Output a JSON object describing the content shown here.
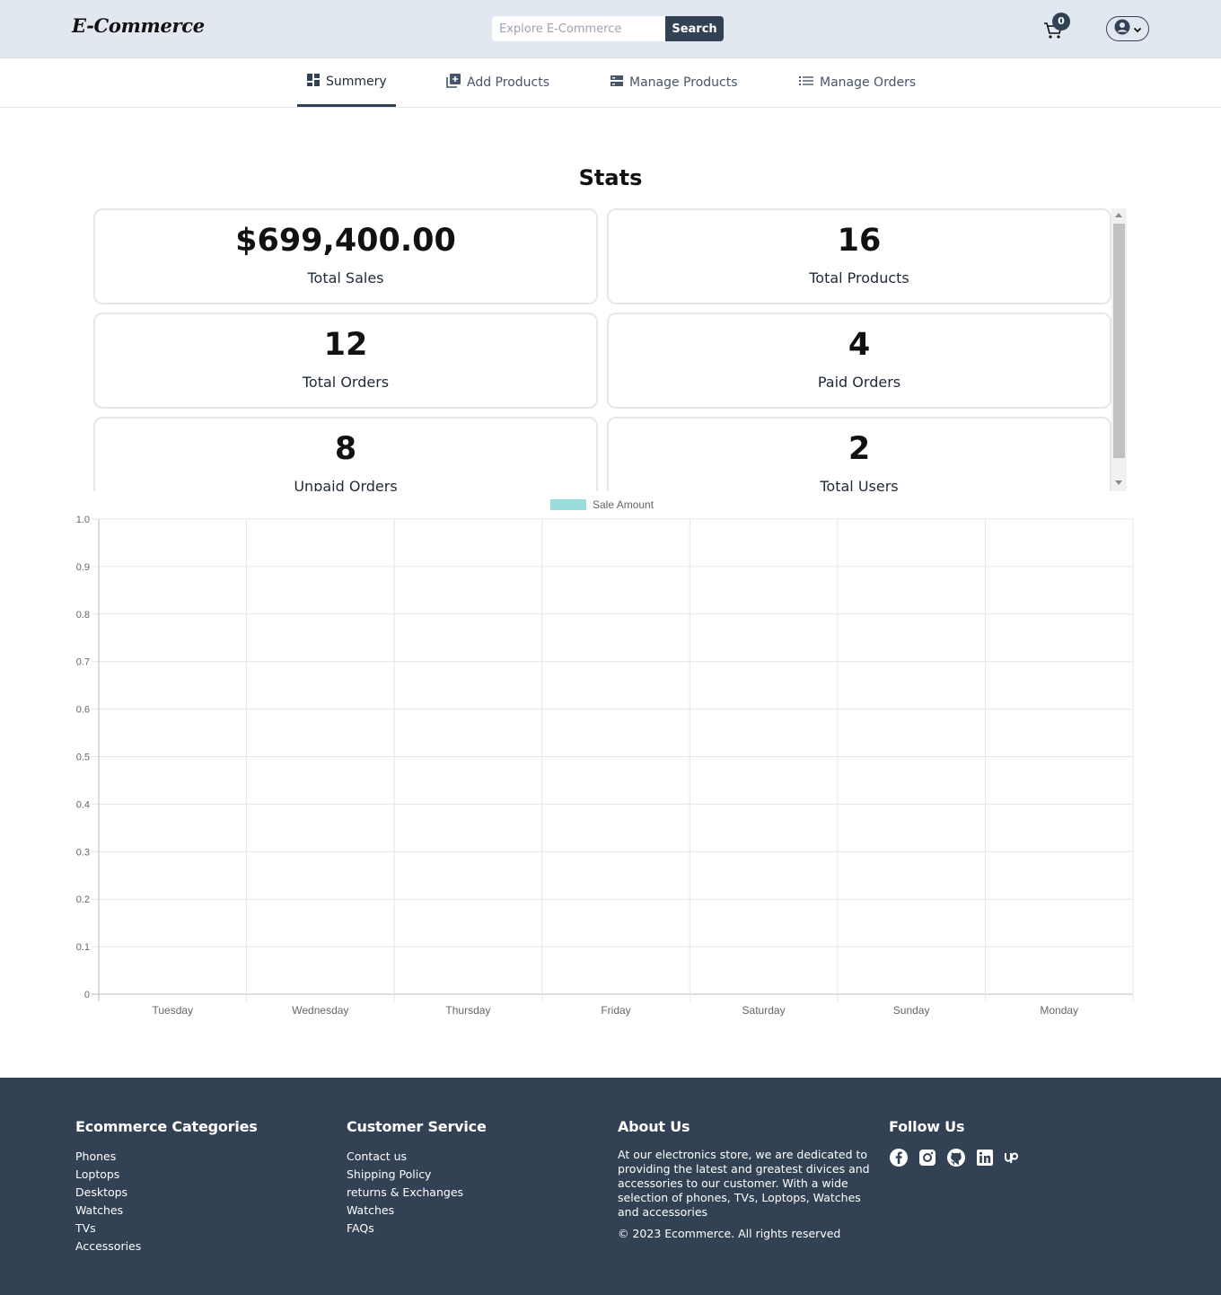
{
  "header": {
    "brand": "E-Commerce",
    "search_placeholder": "Explore E-Commerce",
    "search_button": "Search",
    "cart_count": "0"
  },
  "tabs": [
    {
      "label": "Summery",
      "icon": "dashboard-icon",
      "active": true
    },
    {
      "label": "Add Products",
      "icon": "add-box-icon",
      "active": false
    },
    {
      "label": "Manage Products",
      "icon": "storage-icon",
      "active": false
    },
    {
      "label": "Manage Orders",
      "icon": "list-icon",
      "active": false
    }
  ],
  "stats": {
    "title": "Stats",
    "cards": [
      {
        "value": "$699,400.00",
        "label": "Total Sales"
      },
      {
        "value": "16",
        "label": "Total Products"
      },
      {
        "value": "12",
        "label": "Total Orders"
      },
      {
        "value": "4",
        "label": "Paid Orders"
      },
      {
        "value": "8",
        "label": "Unpaid Orders"
      },
      {
        "value": "2",
        "label": "Total Users"
      }
    ]
  },
  "chart_data": {
    "type": "bar",
    "categories": [
      "Tuesday",
      "Wednesday",
      "Thursday",
      "Friday",
      "Saturday",
      "Sunday",
      "Monday"
    ],
    "series": [
      {
        "name": "Sale Amount",
        "values": [
          0,
          0,
          0,
          0,
          0,
          0,
          0
        ],
        "color": "#99dddd"
      }
    ],
    "yticks": [
      "0",
      "0.1",
      "0.2",
      "0.3",
      "0.4",
      "0.5",
      "0.6",
      "0.7",
      "0.8",
      "0.9",
      "1.0"
    ],
    "ylim": [
      0,
      1
    ],
    "grid": true,
    "legend": "top-center"
  },
  "footer": {
    "categories": {
      "title": "Ecommerce Categories",
      "links": [
        "Phones",
        "Loptops",
        "Desktops",
        "Watches",
        "TVs",
        "Accessories"
      ]
    },
    "service": {
      "title": "Customer Service",
      "links": [
        "Contact us",
        "Shipping Policy",
        "returns & Exchanges",
        "Watches",
        "FAQs"
      ]
    },
    "about": {
      "title": "About Us",
      "text": "At our electronics store, we are dedicated to providing the latest and greatest divices and accessories to our customer. With a wide selection of phones, TVs, Loptops, Watches and accessories",
      "copyright": "© 2023 Ecommerce. All rights reserved"
    },
    "follow": {
      "title": "Follow Us",
      "icons": [
        "facebook-icon",
        "instagram-icon",
        "github-icon",
        "linkedin-icon",
        "upwork-icon"
      ]
    }
  }
}
